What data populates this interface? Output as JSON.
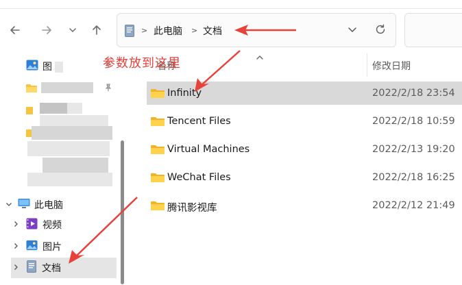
{
  "window": {
    "nav": {
      "back_icon": "back-arrow-icon",
      "forward_icon": "forward-arrow-icon",
      "recent_icon": "chevron-down-icon",
      "up_icon": "up-arrow-icon"
    },
    "address_bar": {
      "location_icon": "documents-icon",
      "crumbs": [
        "此电脑",
        "文档"
      ],
      "separator": ">"
    },
    "search": {
      "placeholder": ""
    }
  },
  "annotation": {
    "text": "参数放到这里",
    "color": "#e8413a"
  },
  "columns": {
    "name": "名称",
    "modified": "修改日期"
  },
  "sidebar": {
    "pinned": [
      {
        "label": "图",
        "icon": "pictures-icon"
      },
      {
        "label": "",
        "icon": "folder-icon"
      },
      {
        "label": "",
        "icon": "folder-icon"
      },
      {
        "label": "",
        "icon": "folder-icon"
      }
    ],
    "this_pc": {
      "label": "此电脑",
      "icon": "computer-icon"
    },
    "children": [
      {
        "label": "视频",
        "icon": "videos-icon"
      },
      {
        "label": "图片",
        "icon": "pictures-icon"
      },
      {
        "label": "文档",
        "icon": "documents-icon",
        "selected": true
      }
    ]
  },
  "files": [
    {
      "name": "Infinity",
      "modified": "2022/2/18 23:54",
      "selected": true
    },
    {
      "name": "Tencent Files",
      "modified": "2022/2/18 10:59"
    },
    {
      "name": "Virtual Machines",
      "modified": "2022/2/13 19:20"
    },
    {
      "name": "WeChat Files",
      "modified": "2022/2/18 16:25"
    },
    {
      "name": "腾讯影视库",
      "modified": "2022/2/12 21:49"
    }
  ]
}
